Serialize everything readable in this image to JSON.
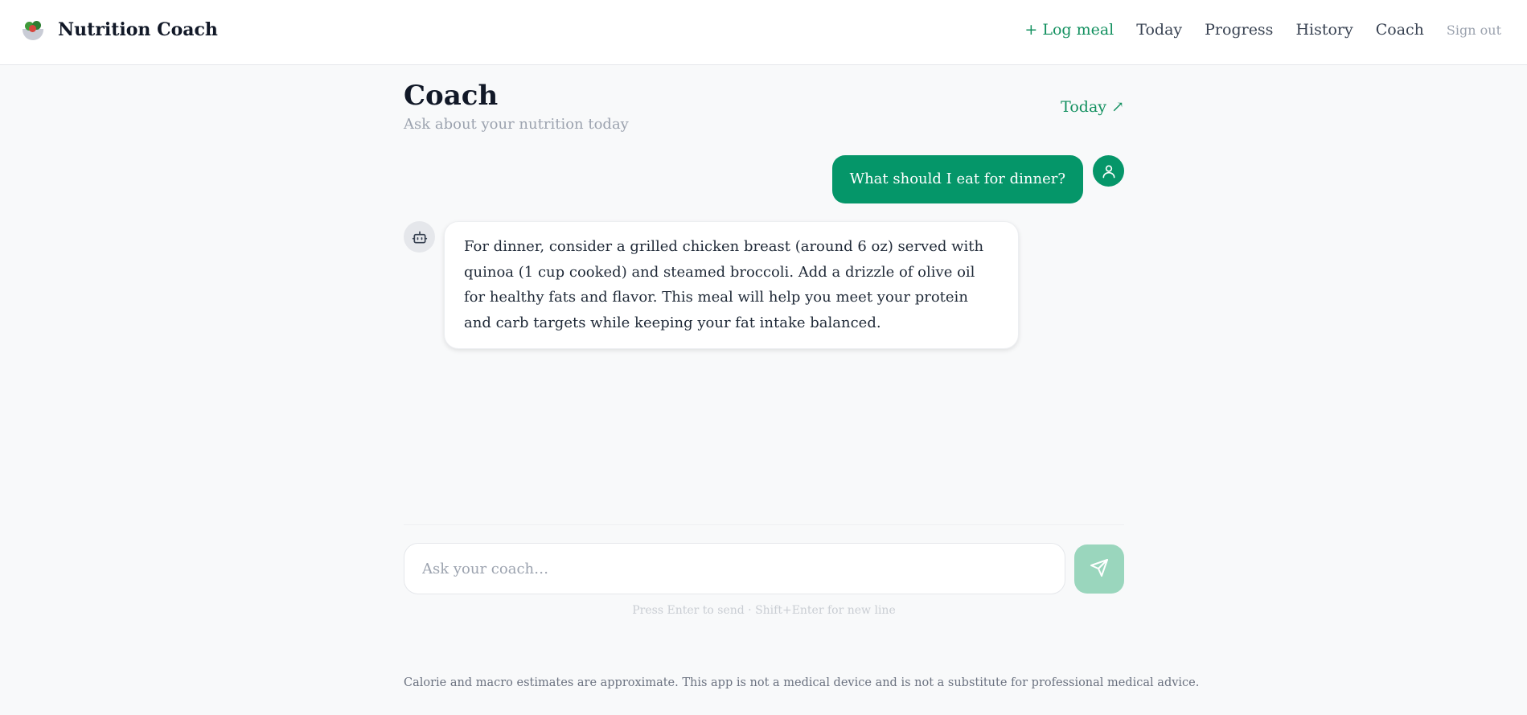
{
  "header": {
    "brand": "Nutrition Coach",
    "logo_icon": "salad-bowl-icon",
    "nav": {
      "log_meal": "+ Log meal",
      "today": "Today",
      "progress": "Progress",
      "history": "History",
      "coach": "Coach",
      "sign_out": "Sign out"
    }
  },
  "page": {
    "title": "Coach",
    "subtitle": "Ask about your nutrition today",
    "today_link": "Today ↗"
  },
  "messages": [
    {
      "role": "user",
      "avatar_icon": "user-icon",
      "text": "What should I eat for dinner?"
    },
    {
      "role": "assistant",
      "avatar_icon": "robot-icon",
      "text": "For dinner, consider a grilled chicken breast (around 6 oz) served with quinoa (1 cup cooked) and steamed broccoli. Add a drizzle of olive oil for healthy fats and flavor. This meal will help you meet your protein and carb targets while keeping your fat intake balanced."
    }
  ],
  "composer": {
    "placeholder": "Ask your coach…",
    "value": "",
    "send_icon": "send-icon",
    "hint": "Press Enter to send · Shift+Enter for new line"
  },
  "footer": {
    "disclaimer": "Calorie and macro estimates are approximate. This app is not a medical device and is not a substitute for professional medical advice."
  },
  "colors": {
    "accent": "#059669",
    "accent_link": "#12905f",
    "send_disabled": "#9ad6bd",
    "background": "#f8f9fa"
  }
}
